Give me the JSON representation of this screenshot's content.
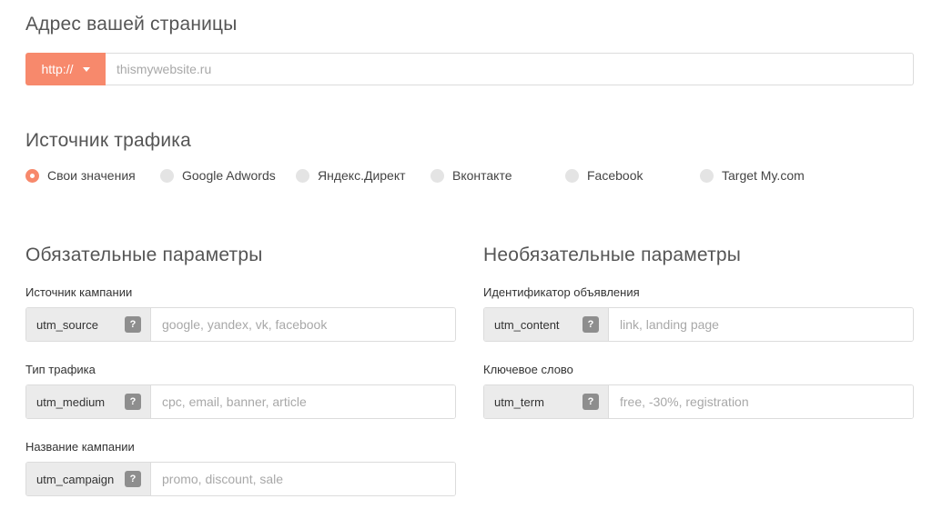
{
  "address": {
    "title": "Адрес вашей страницы",
    "protocol": "http://",
    "placeholder": "thismywebsite.ru"
  },
  "traffic": {
    "title": "Источник трафика",
    "options": [
      {
        "label": "Свои значения",
        "checked": true
      },
      {
        "label": "Google Adwords",
        "checked": false
      },
      {
        "label": "Яндекс.Директ",
        "checked": false
      },
      {
        "label": "Вконтакте",
        "checked": false
      },
      {
        "label": "Facebook",
        "checked": false
      },
      {
        "label": "Target My.com",
        "checked": false
      }
    ]
  },
  "required": {
    "title": "Обязательные параметры",
    "fields": [
      {
        "label": "Источник кампании",
        "param": "utm_source",
        "placeholder": "google, yandex, vk, facebook"
      },
      {
        "label": "Тип трафика",
        "param": "utm_medium",
        "placeholder": "cpc, email, banner, article"
      },
      {
        "label": "Название кампании",
        "param": "utm_campaign",
        "placeholder": "promo, discount, sale"
      }
    ]
  },
  "optional": {
    "title": "Необязательные параметры",
    "fields": [
      {
        "label": "Идентификатор объявления",
        "param": "utm_content",
        "placeholder": "link, landing page"
      },
      {
        "label": "Ключевое слово",
        "param": "utm_term",
        "placeholder": "free, -30%, registration"
      }
    ]
  },
  "help_glyph": "?",
  "colors": {
    "accent": "#f7896c",
    "help": "#8e8e8e",
    "param_bg": "#ebebeb"
  }
}
